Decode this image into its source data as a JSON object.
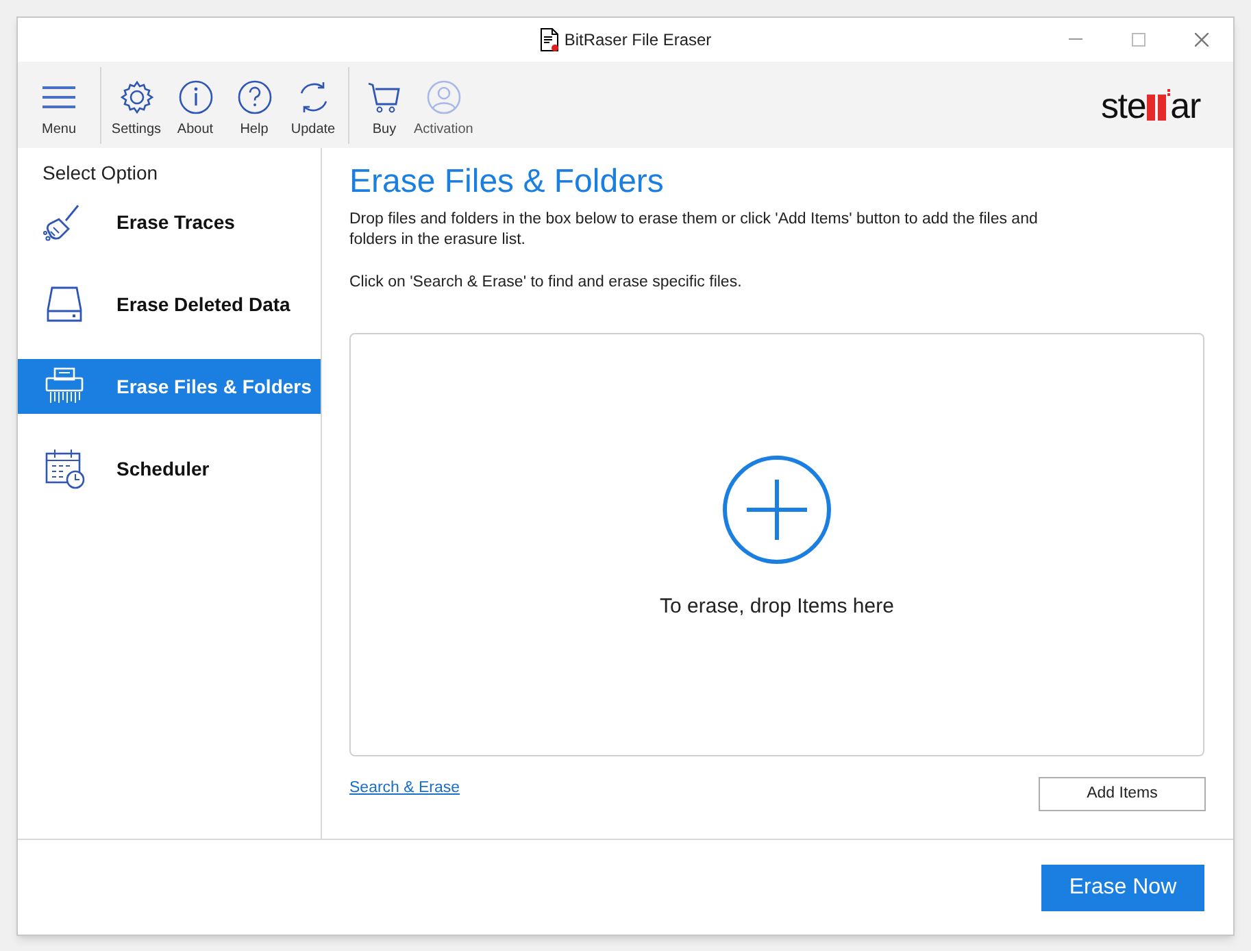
{
  "window": {
    "title": "BitRaser File Eraser"
  },
  "toolbar": {
    "groups": [
      [
        {
          "label": "Menu",
          "kind": "menu"
        }
      ],
      [
        {
          "label": "Settings",
          "kind": "gear"
        },
        {
          "label": "About",
          "kind": "info"
        },
        {
          "label": "Help",
          "kind": "help"
        },
        {
          "label": "Update",
          "kind": "refresh"
        }
      ],
      [
        {
          "label": "Buy",
          "kind": "cart"
        },
        {
          "label": "Activation",
          "kind": "user",
          "disabled": true
        }
      ]
    ]
  },
  "logo": {
    "before": "ste",
    "after": "ar"
  },
  "sidebar": {
    "heading": "Select Option",
    "items": [
      {
        "label": "Erase Traces",
        "kind": "brush",
        "selected": false
      },
      {
        "label": "Erase Deleted Data",
        "kind": "drive",
        "selected": false
      },
      {
        "label": "Erase Files & Folders",
        "kind": "shredder",
        "selected": true
      },
      {
        "label": "Scheduler",
        "kind": "calendar",
        "selected": false
      }
    ]
  },
  "main": {
    "title": "Erase Files & Folders",
    "description": "Drop files and folders in the box below to erase them or click 'Add Items' button to add the files and folders in the erasure list.",
    "hint": "Click on 'Search & Erase' to find and erase specific files.",
    "drop_zone": {
      "label": "To erase, drop Items here"
    },
    "search_link": "Search & Erase",
    "add_button": "Add Items"
  },
  "footer": {
    "primary_button": "Erase Now"
  }
}
